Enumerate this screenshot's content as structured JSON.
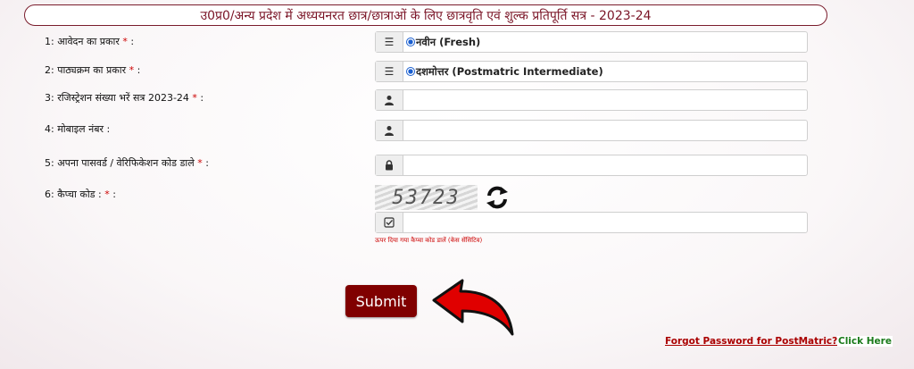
{
  "header": {
    "title": "उ0प्र0/अन्य प्रदेश में अध्ययनरत छात्र/छात्राओं के लिए छात्रवृति एवं शुल्क प्रतिपूर्ति सत्र - 2023-24"
  },
  "form": {
    "application_type": {
      "label": "1: आवेदन का प्रकार",
      "required_mark": "*",
      "suffix": " :",
      "selected_option": "नवीन (Fresh)"
    },
    "course_type": {
      "label": "2: पाठ्यक्रम का प्रकार",
      "required_mark": "*",
      "suffix": " :",
      "selected_option": "दशमोत्तर (Postmatric Intermediate)"
    },
    "registration": {
      "label": "3: रजिस्ट्रेशन संख्या भरें सत्र 2023-24",
      "required_mark": "*",
      "suffix": " :",
      "value": ""
    },
    "mobile": {
      "label": "4: मोबाइल नंबर :",
      "value": ""
    },
    "password": {
      "label": "5: अपना पासवर्ड / वेरिफिकेशन कोड डाले",
      "required_mark": "*",
      "suffix": " :",
      "value": ""
    },
    "captcha": {
      "label": "6: कैप्चा कोड :",
      "required_mark": "*",
      "suffix": " :",
      "code": "53723",
      "value": "",
      "hint": "ऊपर दिया गया कैप्चा कोड डालें (केस सेंसिटिव)"
    }
  },
  "actions": {
    "submit_label": "Submit"
  },
  "footer": {
    "forgot_label": "Forgot Password for PostMatric?",
    "click_here_label": "Click Here"
  },
  "icons": {
    "list": "list-icon",
    "user": "user-icon",
    "lock": "lock-icon",
    "check": "check-square-icon",
    "refresh": "refresh-icon",
    "arrow": "curved-arrow-icon"
  },
  "colors": {
    "title_text": "#7a1426",
    "submit_bg": "#800000",
    "required": "#cc0000",
    "link_red": "#aa0000",
    "link_green": "#1a7a1a",
    "arrow": "#e00000"
  }
}
